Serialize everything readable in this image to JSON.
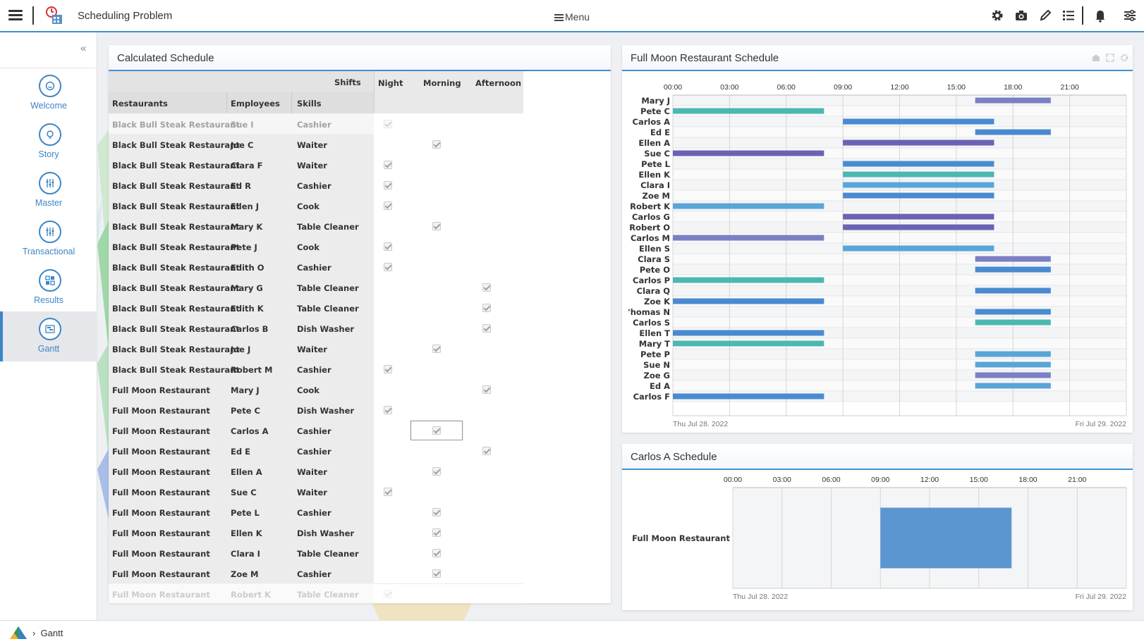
{
  "app": {
    "title": "Scheduling Problem",
    "menu_label": "Menu"
  },
  "sidebar": {
    "items": [
      {
        "label": "Welcome",
        "icon": "smiley-icon"
      },
      {
        "label": "Story",
        "icon": "bulb-icon"
      },
      {
        "label": "Master",
        "icon": "sliders-icon"
      },
      {
        "label": "Transactional",
        "icon": "sliders-icon"
      },
      {
        "label": "Results",
        "icon": "results-icon"
      },
      {
        "label": "Gantt",
        "icon": "gantt-icon",
        "active": true
      }
    ]
  },
  "footer": {
    "breadcrumb": "Gantt"
  },
  "calculated_schedule": {
    "title": "Calculated Schedule",
    "headers": {
      "shifts": "Shifts",
      "night": "Night",
      "morning": "Morning",
      "afternoon": "Afternoon",
      "restaurants": "Restaurants",
      "employees": "Employees",
      "skills": "Skills"
    },
    "rows": [
      {
        "restaurant": "Black Bull Steak Restaurant",
        "employee": "Sue I",
        "skill": "Cashier",
        "shift": "Night",
        "faded": true
      },
      {
        "restaurant": "Black Bull Steak Restaurant",
        "employee": "Joe C",
        "skill": "Waiter",
        "shift": "Morning"
      },
      {
        "restaurant": "Black Bull Steak Restaurant",
        "employee": "Clara F",
        "skill": "Waiter",
        "shift": "Night"
      },
      {
        "restaurant": "Black Bull Steak Restaurant",
        "employee": "Ed R",
        "skill": "Cashier",
        "shift": "Night"
      },
      {
        "restaurant": "Black Bull Steak Restaurant",
        "employee": "Ellen J",
        "skill": "Cook",
        "shift": "Night"
      },
      {
        "restaurant": "Black Bull Steak Restaurant",
        "employee": "Mary K",
        "skill": "Table Cleaner",
        "shift": "Morning"
      },
      {
        "restaurant": "Black Bull Steak Restaurant",
        "employee": "Pete J",
        "skill": "Cook",
        "shift": "Night"
      },
      {
        "restaurant": "Black Bull Steak Restaurant",
        "employee": "Edith O",
        "skill": "Cashier",
        "shift": "Night"
      },
      {
        "restaurant": "Black Bull Steak Restaurant",
        "employee": "Mary G",
        "skill": "Table Cleaner",
        "shift": "Afternoon"
      },
      {
        "restaurant": "Black Bull Steak Restaurant",
        "employee": "Edith K",
        "skill": "Table Cleaner",
        "shift": "Afternoon"
      },
      {
        "restaurant": "Black Bull Steak Restaurant",
        "employee": "Carlos B",
        "skill": "Dish Washer",
        "shift": "Afternoon"
      },
      {
        "restaurant": "Black Bull Steak Restaurant",
        "employee": "Joe J",
        "skill": "Waiter",
        "shift": "Morning"
      },
      {
        "restaurant": "Black Bull Steak Restaurant",
        "employee": "Robert M",
        "skill": "Cashier",
        "shift": "Night"
      },
      {
        "restaurant": "Full Moon Restaurant",
        "employee": "Mary J",
        "skill": "Cook",
        "shift": "Afternoon"
      },
      {
        "restaurant": "Full Moon Restaurant",
        "employee": "Pete C",
        "skill": "Dish Washer",
        "shift": "Night"
      },
      {
        "restaurant": "Full Moon Restaurant",
        "employee": "Carlos A",
        "skill": "Cashier",
        "shift": "Morning",
        "selected": true
      },
      {
        "restaurant": "Full Moon Restaurant",
        "employee": "Ed E",
        "skill": "Cashier",
        "shift": "Afternoon"
      },
      {
        "restaurant": "Full Moon Restaurant",
        "employee": "Ellen A",
        "skill": "Waiter",
        "shift": "Morning"
      },
      {
        "restaurant": "Full Moon Restaurant",
        "employee": "Sue C",
        "skill": "Waiter",
        "shift": "Night"
      },
      {
        "restaurant": "Full Moon Restaurant",
        "employee": "Pete L",
        "skill": "Cashier",
        "shift": "Morning"
      },
      {
        "restaurant": "Full Moon Restaurant",
        "employee": "Ellen K",
        "skill": "Dish Washer",
        "shift": "Morning"
      },
      {
        "restaurant": "Full Moon Restaurant",
        "employee": "Clara I",
        "skill": "Table Cleaner",
        "shift": "Morning"
      },
      {
        "restaurant": "Full Moon Restaurant",
        "employee": "Zoe M",
        "skill": "Cashier",
        "shift": "Morning"
      },
      {
        "restaurant": "Full Moon Restaurant",
        "employee": "Robert K",
        "skill": "Table Cleaner",
        "shift": "Night",
        "faded": true
      }
    ]
  },
  "full_moon_gantt": {
    "title": "Full Moon Restaurant Schedule",
    "ticks": [
      "00:00",
      "03:00",
      "06:00",
      "09:00",
      "12:00",
      "15:00",
      "18:00",
      "21:00"
    ],
    "start_date": "Thu Jul 28. 2022",
    "end_date": "Fri Jul 29. 2022",
    "colors": {
      "purple": "#7b7fc4",
      "teal": "#4cb8b0",
      "blue": "#4a8ad0",
      "indigo": "#6a63b4",
      "sky": "#5aa5d8"
    },
    "rows": [
      {
        "name": "Mary J",
        "start": 16,
        "end": 20,
        "color": "#7b7fc4"
      },
      {
        "name": "Pete C",
        "start": 0,
        "end": 8,
        "color": "#4cb8b0"
      },
      {
        "name": "Carlos A",
        "start": 9,
        "end": 17,
        "color": "#4a8ad0"
      },
      {
        "name": "Ed E",
        "start": 16,
        "end": 20,
        "color": "#4a8ad0"
      },
      {
        "name": "Ellen A",
        "start": 9,
        "end": 17,
        "color": "#6a63b4"
      },
      {
        "name": "Sue C",
        "start": 0,
        "end": 8,
        "color": "#6a63b4"
      },
      {
        "name": "Pete L",
        "start": 9,
        "end": 17,
        "color": "#4a8ad0"
      },
      {
        "name": "Ellen K",
        "start": 9,
        "end": 17,
        "color": "#4cb8b0"
      },
      {
        "name": "Clara I",
        "start": 9,
        "end": 17,
        "color": "#5aa5d8"
      },
      {
        "name": "Zoe M",
        "start": 9,
        "end": 17,
        "color": "#4a8ad0"
      },
      {
        "name": "Robert K",
        "start": 0,
        "end": 8,
        "color": "#5aa5d8"
      },
      {
        "name": "Carlos G",
        "start": 9,
        "end": 17,
        "color": "#6a63b4"
      },
      {
        "name": "Robert O",
        "start": 9,
        "end": 17,
        "color": "#6a63b4"
      },
      {
        "name": "Carlos M",
        "start": 0,
        "end": 8,
        "color": "#7b7fc4"
      },
      {
        "name": "Ellen S",
        "start": 9,
        "end": 17,
        "color": "#5aa5d8"
      },
      {
        "name": "Clara S",
        "start": 16,
        "end": 20,
        "color": "#7b7fc4"
      },
      {
        "name": "Pete O",
        "start": 16,
        "end": 20,
        "color": "#4a8ad0"
      },
      {
        "name": "Carlos P",
        "start": 0,
        "end": 8,
        "color": "#4cb8b0"
      },
      {
        "name": "Clara Q",
        "start": 16,
        "end": 20,
        "color": "#4a8ad0"
      },
      {
        "name": "Zoe K",
        "start": 0,
        "end": 8,
        "color": "#4a8ad0"
      },
      {
        "name": "'homas N",
        "start": 16,
        "end": 20,
        "color": "#4a8ad0"
      },
      {
        "name": "Carlos S",
        "start": 16,
        "end": 20,
        "color": "#4cb8b0"
      },
      {
        "name": "Ellen T",
        "start": 0,
        "end": 8,
        "color": "#4a8ad0"
      },
      {
        "name": "Mary T",
        "start": 0,
        "end": 8,
        "color": "#4cb8b0"
      },
      {
        "name": "Pete P",
        "start": 16,
        "end": 20,
        "color": "#5aa5d8"
      },
      {
        "name": "Sue N",
        "start": 16,
        "end": 20,
        "color": "#5aa5d8"
      },
      {
        "name": "Zoe G",
        "start": 16,
        "end": 20,
        "color": "#7b7fc4"
      },
      {
        "name": "Ed A",
        "start": 16,
        "end": 20,
        "color": "#5aa5d8"
      },
      {
        "name": "Carlos F",
        "start": 0,
        "end": 8,
        "color": "#4a8ad0"
      }
    ]
  },
  "carlos_gantt": {
    "title": "Carlos A Schedule",
    "ticks": [
      "00:00",
      "03:00",
      "06:00",
      "09:00",
      "12:00",
      "15:00",
      "18:00",
      "21:00"
    ],
    "start_date": "Thu Jul 28. 2022",
    "end_date": "Fri Jul 29. 2022",
    "rows": [
      {
        "name": "Full Moon Restaurant",
        "start": 9,
        "end": 17,
        "color": "#5b96d0"
      }
    ]
  }
}
